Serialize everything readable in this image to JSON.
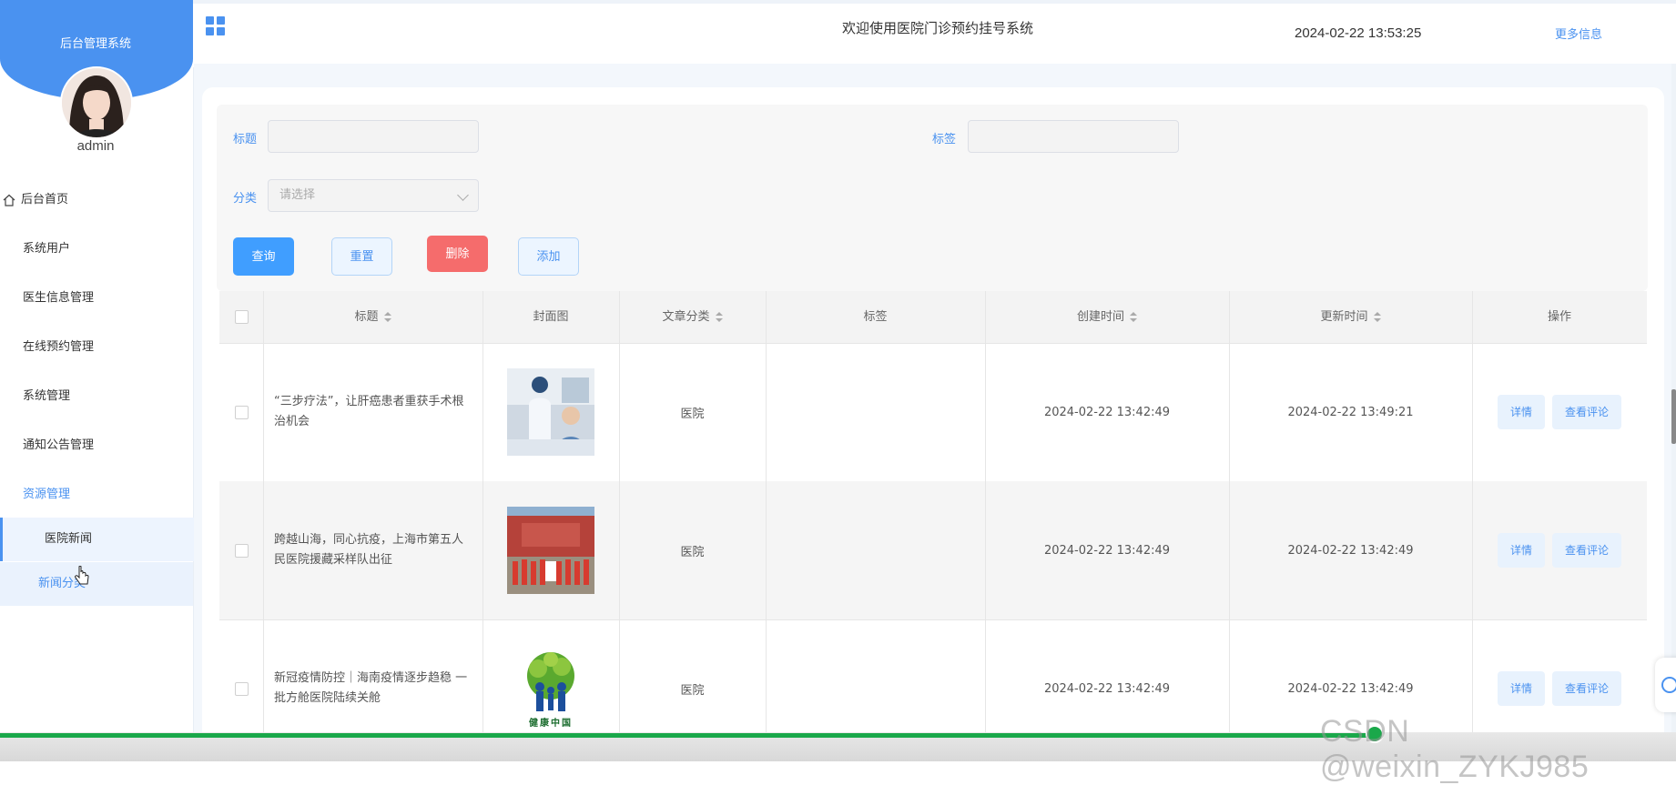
{
  "sidebar": {
    "brand_title": "后台管理系统",
    "username": "admin",
    "menu": [
      {
        "label": "后台首页"
      },
      {
        "label": "系统用户"
      },
      {
        "label": "医生信息管理"
      },
      {
        "label": "在线预约管理"
      },
      {
        "label": "系统管理"
      },
      {
        "label": "通知公告管理"
      },
      {
        "label": "资源管理"
      }
    ],
    "submenu": [
      {
        "label": "医院新闻"
      },
      {
        "label": "新闻分类"
      }
    ]
  },
  "header": {
    "title": "欢迎使用医院门诊预约挂号系统",
    "datetime": "2024-02-22 13:53:25",
    "more_info": "更多信息"
  },
  "search": {
    "title_label": "标题",
    "title_value": "",
    "tag_label": "标签",
    "tag_value": "",
    "category_label": "分类",
    "category_placeholder": "请选择"
  },
  "actions": {
    "query": "查询",
    "reset": "重置",
    "delete": "删除",
    "add": "添加"
  },
  "table": {
    "columns": [
      "标题",
      "封面图",
      "文章分类",
      "标签",
      "创建时间",
      "更新时间",
      "操作"
    ],
    "rows": [
      {
        "title": "“三步疗法”，让肝癌患者重获手术根治机会",
        "category": "医院",
        "tag": "",
        "created": "2024-02-22 13:42:49",
        "updated": "2024-02-22 13:49:21",
        "cover": "doctor-photo"
      },
      {
        "title": "跨越山海，同心抗疫，上海市第五人民医院援藏采样队出征",
        "category": "医院",
        "tag": "",
        "created": "2024-02-22 13:42:49",
        "updated": "2024-02-22 13:42:49",
        "cover": "team-photo"
      },
      {
        "title": "新冠疫情防控｜海南疫情逐步趋稳 一批方舱医院陆续关舱",
        "category": "医院",
        "tag": "",
        "created": "2024-02-22 13:42:49",
        "updated": "2024-02-22 13:42:49",
        "cover": "health-china-logo"
      }
    ],
    "row_actions": {
      "detail": "详情",
      "comments": "查看评论"
    }
  },
  "logo_text": {
    "health_china": "健康中国"
  },
  "video_progress": 0.82,
  "watermark": "CSDN @weixin_ZYKJ985",
  "colors": {
    "accent": "#4a92f0",
    "danger": "#f56c6c",
    "progress": "#1aa84a"
  }
}
